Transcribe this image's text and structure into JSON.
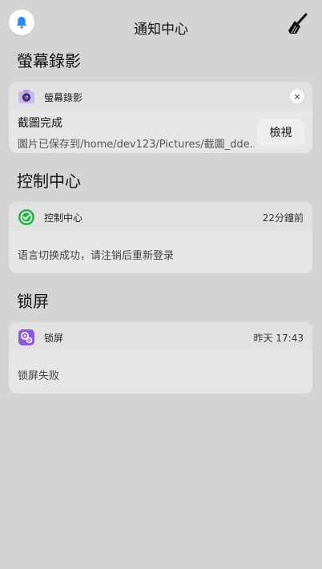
{
  "header": {
    "title": "通知中心",
    "bell_icon": "bell-icon",
    "clear_icon": "broom-icon"
  },
  "groups": [
    {
      "title": "螢幕錄影",
      "app_name": "螢幕錄影",
      "icon": "camera-icon",
      "notification_title": "截圖完成",
      "notification_body": "圖片已保存到/home/dev123/Pictures/截圖_dde…",
      "action_label": "檢視",
      "close_label": "×"
    },
    {
      "title": "控制中心",
      "app_name": "控制中心",
      "icon": "control-center-icon",
      "time": "22分鐘前",
      "notification_body": "语言切换成功，请注销后重新登录"
    },
    {
      "title": "锁屏",
      "app_name": "锁屏",
      "icon": "lock-screen-icon",
      "time": "昨天 17:43",
      "notification_body": "锁屏失败"
    }
  ],
  "colors": {
    "background": "#d4d4d4",
    "card": "#e6e6e6",
    "accent_blue": "#2a8cf0",
    "control_green": "#2bb34a",
    "lock_purple": "#8a5ad8"
  }
}
